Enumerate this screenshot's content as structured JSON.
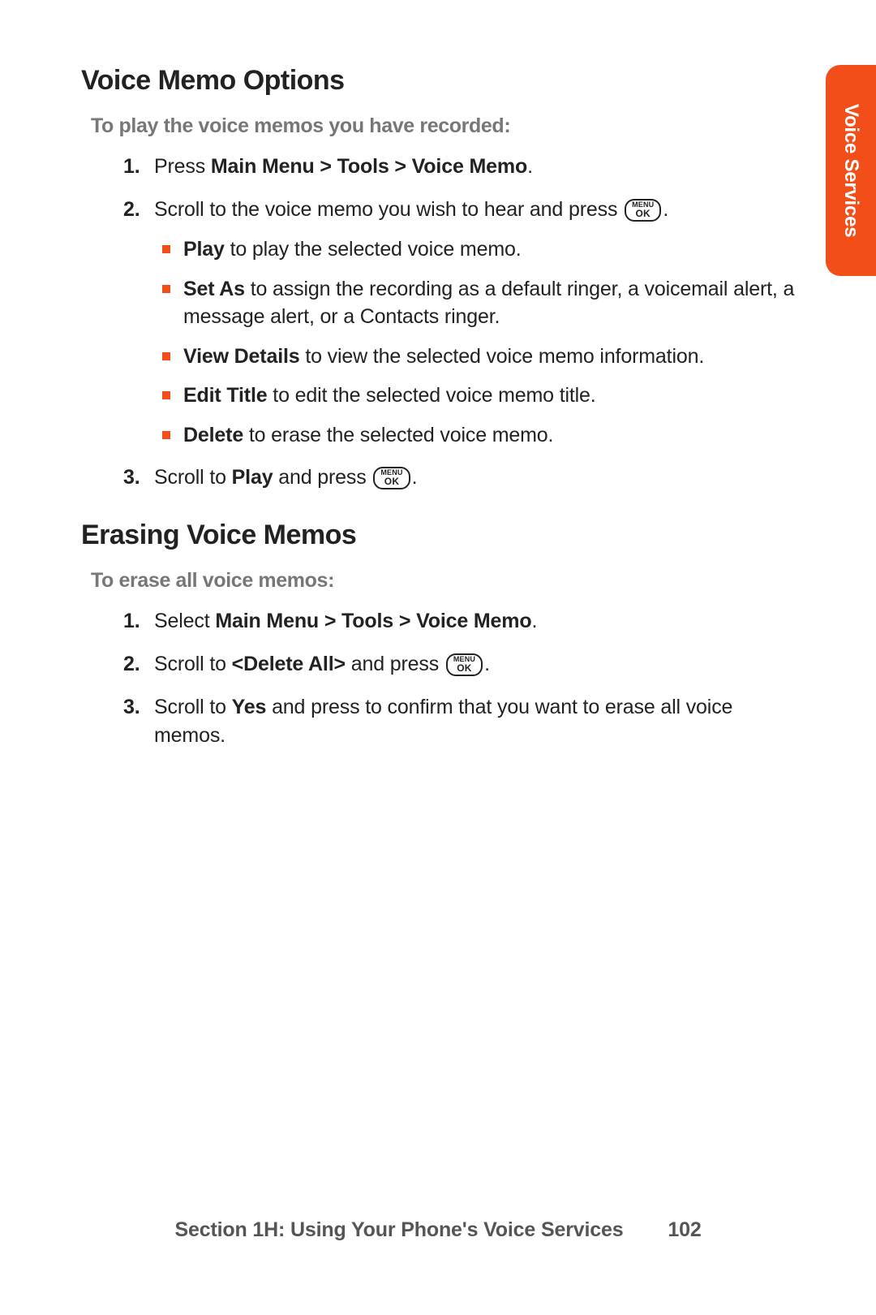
{
  "sideTab": "Voice Services",
  "key": {
    "line1": "MENU",
    "line2": "OK"
  },
  "section1": {
    "title": "Voice Memo Options",
    "subheading": "To play the voice memos you have recorded:",
    "step1": {
      "num": "1.",
      "pre": "Press ",
      "bold": "Main Menu > Tools > Voice Memo",
      "post": "."
    },
    "step2": {
      "num": "2.",
      "pre": "Scroll to the voice memo you wish to hear and press ",
      "post": "."
    },
    "bullets": [
      {
        "bold": "Play",
        "rest": " to play the selected voice memo."
      },
      {
        "bold": "Set As",
        "rest": "  to assign the recording as a default ringer, a voicemail alert, a message alert, or a Contacts ringer."
      },
      {
        "bold": "View Details",
        "rest": " to view the selected voice memo information."
      },
      {
        "bold": "Edit Title",
        "rest": " to edit the selected voice memo title."
      },
      {
        "bold": "Delete",
        "rest": " to erase the selected voice memo."
      }
    ],
    "step3": {
      "num": "3.",
      "pre": "Scroll to ",
      "bold": "Play",
      "mid": " and press ",
      "post": "."
    }
  },
  "section2": {
    "title": "Erasing Voice Memos",
    "subheading": "To erase all voice memos:",
    "step1": {
      "num": "1.",
      "pre": "Select ",
      "bold": "Main Menu > Tools > Voice Memo",
      "post": "."
    },
    "step2": {
      "num": "2.",
      "pre": "Scroll to ",
      "bold": "<Delete  All>",
      "mid": " and press ",
      "post": "."
    },
    "step3": {
      "num": "3.",
      "pre": "Scroll to ",
      "bold": "Yes",
      "post": " and press  to confirm that you want to erase all voice memos."
    }
  },
  "footer": {
    "label": "Section 1H: Using Your Phone's Voice Services",
    "page": "102"
  }
}
